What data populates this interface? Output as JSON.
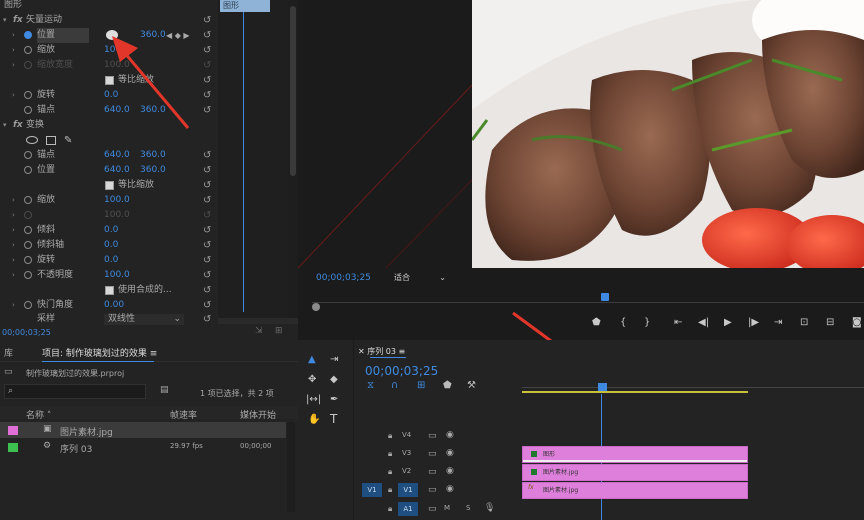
{
  "effect_controls": {
    "header_label": "图形",
    "clip_tab": "图形",
    "vector_motion": "矢量运动",
    "fx": "fx",
    "position_label": "位置",
    "position_x": "640.0",
    "position_y": "360.0",
    "scale_label": "缩放",
    "scale_value": "100.0",
    "scale_width_label": "缩放宽度",
    "scale_width_value": "100.0",
    "uniform_scale": "等比缩放",
    "rotation_label": "旋转",
    "rotation_value": "0.0",
    "anchor_label": "锚点",
    "anchor_x": "640.0",
    "anchor_y": "360.0",
    "transform_label": "变换",
    "t_anchor_label": "锚点",
    "t_anchor_x": "640.0",
    "t_anchor_y": "360.0",
    "t_position_label": "位置",
    "t_position_x": "640.0",
    "t_position_y": "360.0",
    "t_uniform_scale": "等比缩放",
    "t_scale_label": "缩放",
    "t_scale_value": "100.0",
    "t_scale_width_value": "100.0",
    "skew_label": "倾斜",
    "skew_value": "0.0",
    "skew_axis_label": "倾斜轴",
    "skew_axis_value": "0.0",
    "t_rotation_label": "旋转",
    "t_rotation_value": "0.0",
    "opacity_label": "不透明度",
    "opacity_value": "100.0",
    "use_comp_shutter": "使用合成的...",
    "shutter_angle_label": "快门角度",
    "shutter_angle_value": "0.00",
    "sampling_label": "采样",
    "sampling_value": "双线性",
    "timecode": "00;00;03;25"
  },
  "program_monitor": {
    "timecode": "00;00;03;25",
    "fit_label": "适合"
  },
  "project_panel": {
    "lib_tab": "库",
    "title": "项目: 制作玻璃划过的效果",
    "menu_icon": "≡",
    "project_file": "制作玻璃划过的效果.prproj",
    "selection_info": "1 项已选择，共 2 项",
    "col_name": "名称",
    "col_framerate": "帧速率",
    "col_media_start": "媒体开始",
    "items": [
      {
        "name": "图片素材.jpg",
        "framerate": "",
        "start": "",
        "color": "#e070d8"
      },
      {
        "name": "序列 03",
        "framerate": "29.97 fps",
        "start": "00;00;00",
        "color": "#3ec051"
      }
    ]
  },
  "timeline": {
    "sequence_tab": "序列 03",
    "menu_icon": "≡",
    "timecode": "00;00;03;25",
    "tracks": [
      {
        "name": "V4"
      },
      {
        "name": "V3"
      },
      {
        "name": "V2"
      },
      {
        "name": "V1",
        "source": "V1"
      },
      {
        "name": "A1"
      }
    ],
    "clips": [
      {
        "track": "V3",
        "label": "图形"
      },
      {
        "track": "V2",
        "label": "图片素材.jpg"
      },
      {
        "track": "V1",
        "label": "图片素材.jpg",
        "fx": "fx"
      }
    ],
    "audio_m": "M",
    "audio_s": "S"
  },
  "tools": {
    "type_tool": "T"
  },
  "colors": {
    "accent_blue": "#3f8ae0",
    "clip_pink": "#df7fdc",
    "panel_bg": "#232323",
    "annotation_red": "#e2362a"
  }
}
